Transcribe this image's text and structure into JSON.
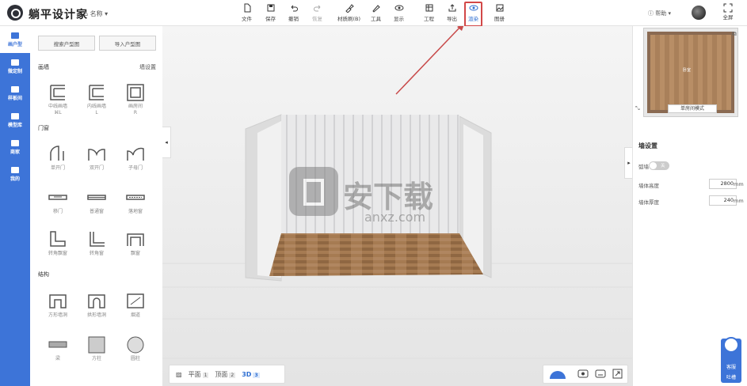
{
  "header": {
    "app_name": "躺平设计家",
    "project_name": "名称",
    "toolbar": [
      {
        "label": "文件",
        "icon": "file-icon"
      },
      {
        "label": "保存",
        "icon": "save-icon"
      },
      {
        "label": "撤销",
        "icon": "undo-icon"
      },
      {
        "label": "恢复",
        "icon": "redo-icon"
      },
      {
        "label": "材质刷(B)",
        "icon": "brush-icon"
      },
      {
        "label": "工具",
        "icon": "tools-icon"
      },
      {
        "label": "显示",
        "icon": "eye-icon"
      },
      {
        "label": "工程",
        "icon": "project-icon"
      },
      {
        "label": "导出",
        "icon": "export-icon"
      },
      {
        "label": "渲染",
        "icon": "render-icon"
      },
      {
        "label": "图册",
        "icon": "album-icon"
      }
    ],
    "help": "帮助",
    "fullscreen": "全屏"
  },
  "leftnav": [
    {
      "label": "画户型"
    },
    {
      "label": "微定制"
    },
    {
      "label": "样板间"
    },
    {
      "label": "模型库"
    },
    {
      "label": "商家"
    },
    {
      "label": "我的"
    }
  ],
  "panel": {
    "search_btn": "搜索户型图",
    "import_btn": "导入户型图",
    "wall_section": "画墙",
    "wall_settings": "墙设置",
    "walls": [
      "中线画墙\n⌘L",
      "内线画墙\nL",
      "画房间\nR"
    ],
    "door_section": "门窗",
    "doors": [
      "单开门",
      "双开门",
      "子母门",
      "移门",
      "普通窗",
      "落地窗",
      "转角飘窗",
      "转角窗",
      "飘窗"
    ],
    "struct_section": "结构",
    "structs": [
      "方形墙洞",
      "拱形墙洞",
      "烟道",
      "梁",
      "方柱",
      "圆柱"
    ]
  },
  "viewport": {
    "watermark": "安下载",
    "watermark_sub": "anxz.com",
    "views": [
      {
        "label": "平面",
        "num": "1"
      },
      {
        "label": "顶面",
        "num": "2"
      },
      {
        "label": "3D",
        "num": "3"
      }
    ]
  },
  "rpanel": {
    "room_label": "卧室",
    "mode": "单房间模式",
    "title": "墙设置",
    "toggle_label": "弧墙",
    "toggle_state": "关",
    "height_label": "墙体高度",
    "height_value": "2800",
    "thickness_label": "墙体厚度",
    "thickness_value": "240",
    "unit": "mm"
  },
  "service": {
    "line1": "客服",
    "line2": "吐槽"
  },
  "colors": {
    "accent": "#3d74d8",
    "highlight": "#d24848",
    "arrow": "#c84a4a"
  }
}
